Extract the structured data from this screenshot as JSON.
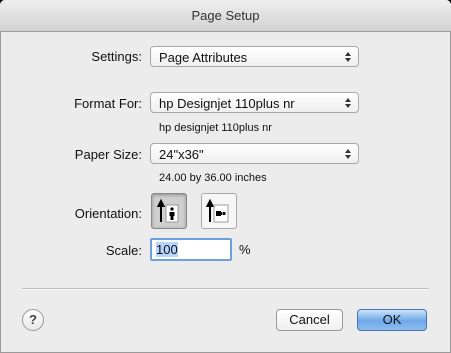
{
  "window": {
    "title": "Page Setup"
  },
  "settings": {
    "label": "Settings:",
    "value": "Page Attributes"
  },
  "format_for": {
    "label": "Format For:",
    "value": "hp Designjet 110plus nr",
    "detail": "hp designjet 110plus nr"
  },
  "paper_size": {
    "label": "Paper Size:",
    "value": "24\"x36\"",
    "detail": "24.00 by 36.00 inches"
  },
  "orientation": {
    "label": "Orientation:",
    "options": [
      "portrait",
      "landscape"
    ],
    "selected": "portrait"
  },
  "scale": {
    "label": "Scale:",
    "value": "100",
    "unit": "%"
  },
  "buttons": {
    "help": "?",
    "cancel": "Cancel",
    "ok": "OK"
  },
  "icons": {
    "popup": "up-down-arrows-icon",
    "portrait": "portrait-orientation-icon",
    "landscape": "landscape-orientation-icon"
  }
}
